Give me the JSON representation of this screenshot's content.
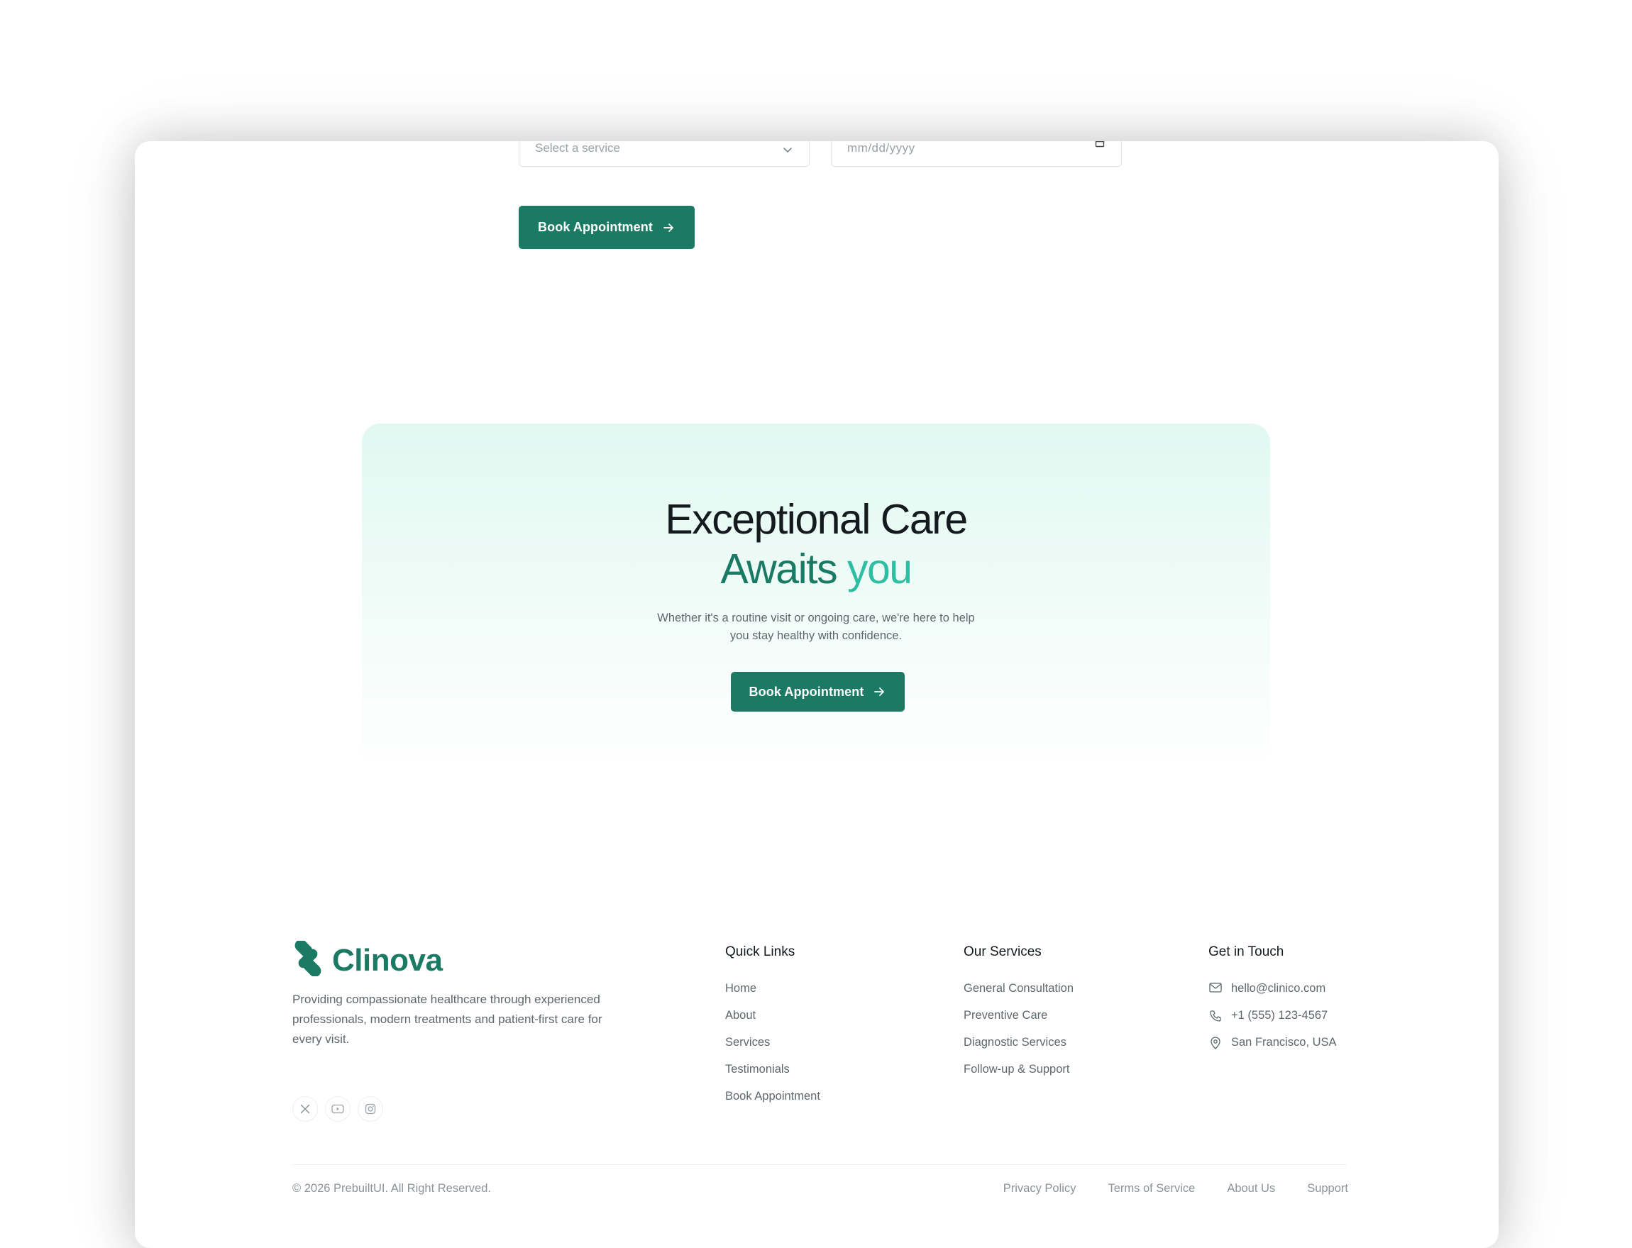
{
  "booking_form": {
    "service_placeholder": "Select a service",
    "date_placeholder": "mm/dd/yyyy",
    "submit_label": "Book Appointment"
  },
  "cta": {
    "title_line1": "Exceptional Care",
    "title_line2_word1": "Awaits",
    "title_line2_word2": "you",
    "subtitle": "Whether it's a routine visit or ongoing care, we're here to help you stay healthy with confidence.",
    "button_label": "Book Appointment"
  },
  "footer": {
    "brand": {
      "name": "Clinova",
      "description": "Providing compassionate healthcare through experienced professionals, modern treatments and patient-first care for every visit.",
      "socials": [
        "x-icon",
        "youtube-icon",
        "instagram-icon"
      ]
    },
    "quick_links": {
      "title": "Quick Links",
      "items": [
        "Home",
        "About",
        "Services",
        "Testimonials",
        "Book Appointment"
      ]
    },
    "services": {
      "title": "Our Services",
      "items": [
        "General Consultation",
        "Preventive Care",
        "Diagnostic Services",
        "Follow-up & Support"
      ]
    },
    "contact": {
      "title": "Get in Touch",
      "email": "hello@clinico.com",
      "phone": "+1 (555) 123-4567",
      "location": "San Francisco, USA"
    },
    "copyright": "© 2026 PrebuiltUI. All Right Reserved.",
    "legal_links": [
      "Privacy Policy",
      "Terms of Service",
      "About Us",
      "Support"
    ]
  },
  "colors": {
    "brand_green": "#1b7a63",
    "accent_teal": "#2ebfa2",
    "text_dark": "#151a1e",
    "text_muted": "#5f676c"
  }
}
